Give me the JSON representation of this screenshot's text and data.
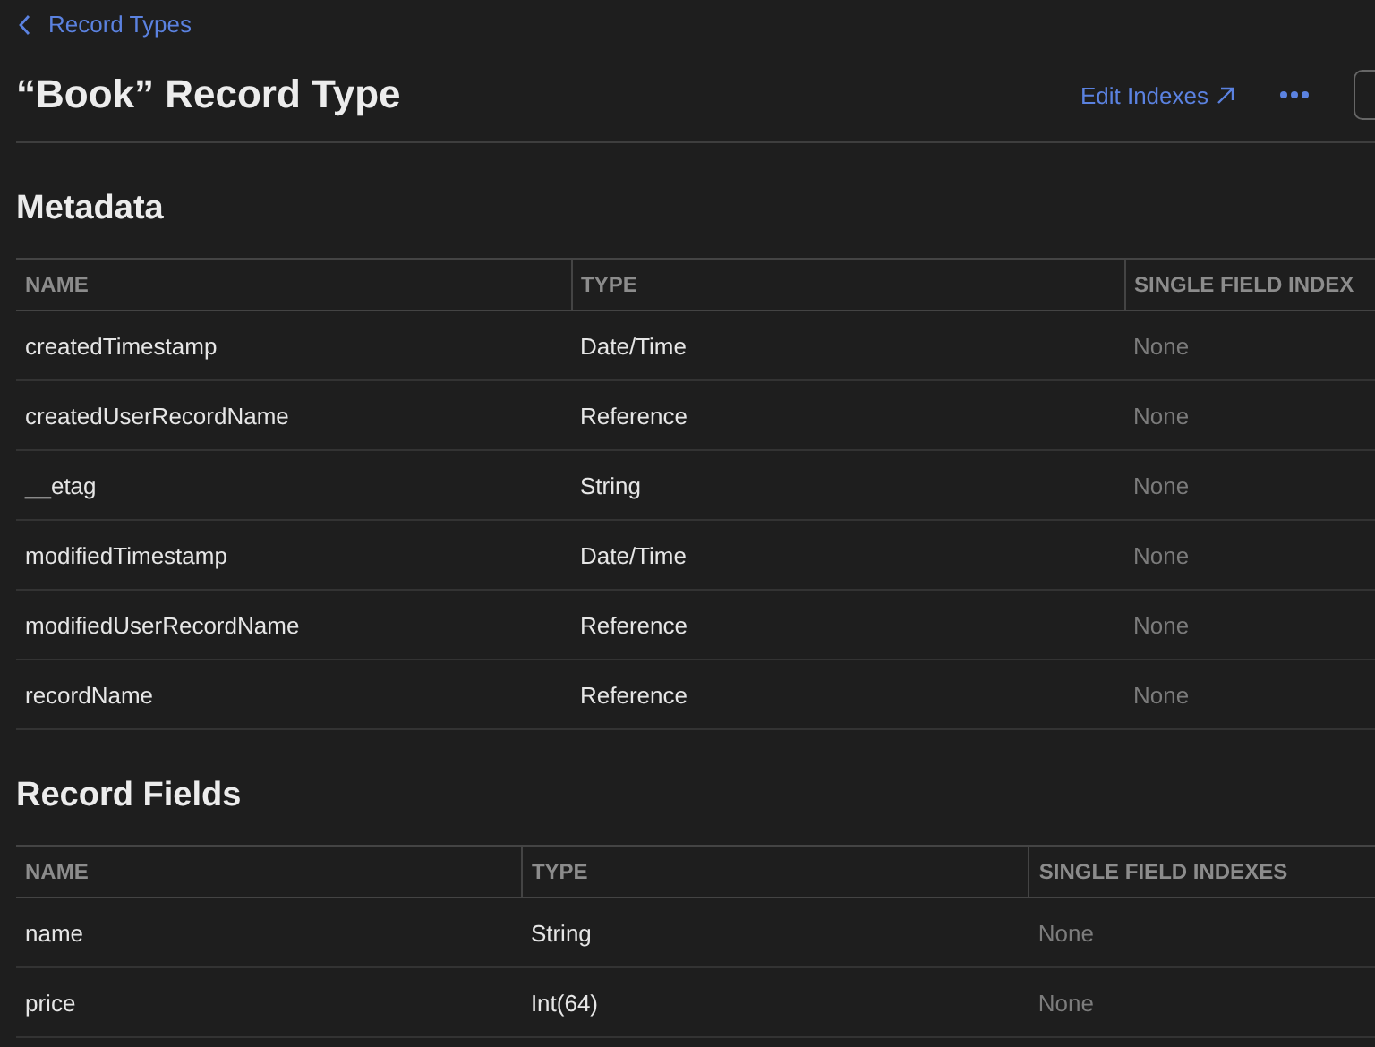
{
  "breadcrumb": {
    "label": "Record Types"
  },
  "title": "“Book” Record Type",
  "actions": {
    "edit_indexes": "Edit Indexes"
  },
  "sections": [
    {
      "title": "Metadata",
      "columns": [
        "NAME",
        "TYPE",
        "SINGLE FIELD INDEX"
      ],
      "rows": [
        [
          "createdTimestamp",
          "Date/Time",
          "None"
        ],
        [
          "createdUserRecordName",
          "Reference",
          "None"
        ],
        [
          "__etag",
          "String",
          "None"
        ],
        [
          "modifiedTimestamp",
          "Date/Time",
          "None"
        ],
        [
          "modifiedUserRecordName",
          "Reference",
          "None"
        ],
        [
          "recordName",
          "Reference",
          "None"
        ]
      ]
    },
    {
      "title": "Record Fields",
      "columns": [
        "NAME",
        "TYPE",
        "SINGLE FIELD INDEXES"
      ],
      "rows": [
        [
          "name",
          "String",
          "None"
        ],
        [
          "price",
          "Int(64)",
          "None"
        ]
      ]
    }
  ]
}
